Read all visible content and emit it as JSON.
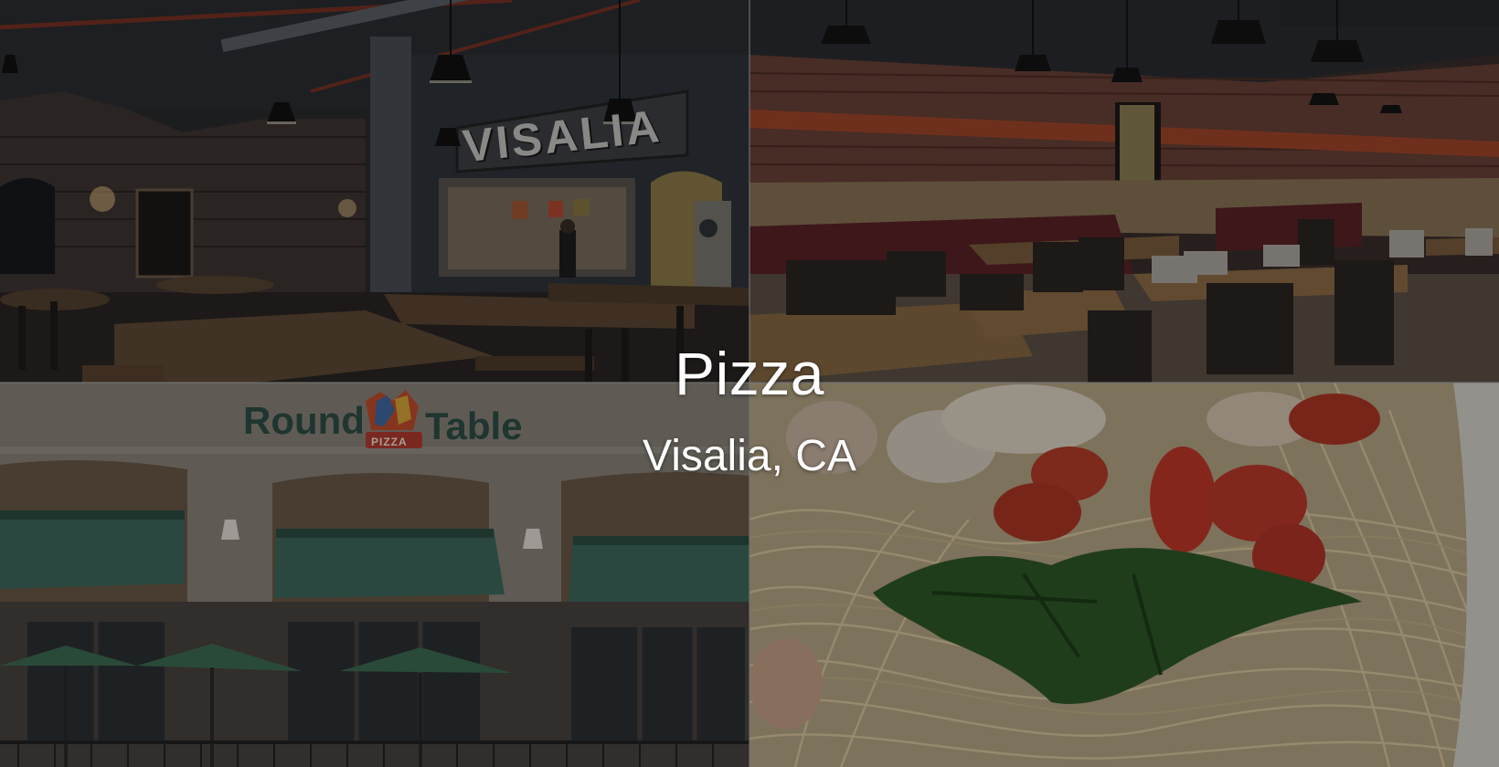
{
  "hero": {
    "title": "Pizza",
    "subtitle": "Visalia, CA"
  },
  "photos": {
    "interior_sign": "VISALIA",
    "storefront_logo_left": "Round",
    "storefront_logo_badge": "PIZZA",
    "storefront_logo_right": "Table"
  },
  "colors": {
    "accent_orange": "#c2552c",
    "awning_green": "#3f6b5f",
    "text": "#ffffff"
  }
}
